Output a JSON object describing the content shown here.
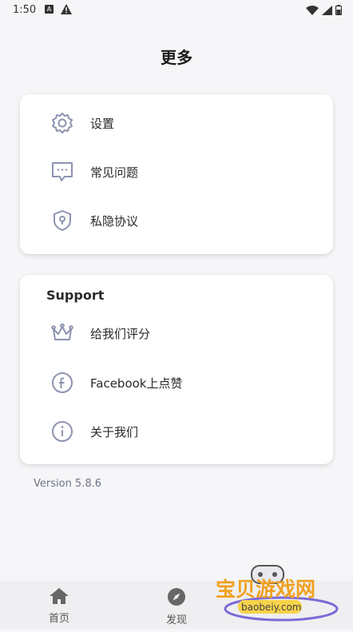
{
  "status": {
    "time": "1:50",
    "badge": "A"
  },
  "page": {
    "title": "更多"
  },
  "menu1": [
    {
      "label": "设置",
      "icon": "gear-icon"
    },
    {
      "label": "常见问题",
      "icon": "chat-bubble-icon"
    },
    {
      "label": "私隐协议",
      "icon": "shield-icon"
    }
  ],
  "support": {
    "title": "Support",
    "items": [
      {
        "label": "给我们评分",
        "icon": "crown-icon"
      },
      {
        "label": "Facebook上点赞",
        "icon": "facebook-icon"
      },
      {
        "label": "关于我们",
        "icon": "info-icon"
      }
    ]
  },
  "version": "Version 5.8.6",
  "nav": {
    "home": "首页",
    "discover": "发现"
  },
  "watermark": {
    "text": "宝贝游戏网",
    "url": "baobeiy.com"
  },
  "colors": {
    "icon": "#8e93b0",
    "accent": "#7b6bd6",
    "watermark": "#f0a020"
  }
}
